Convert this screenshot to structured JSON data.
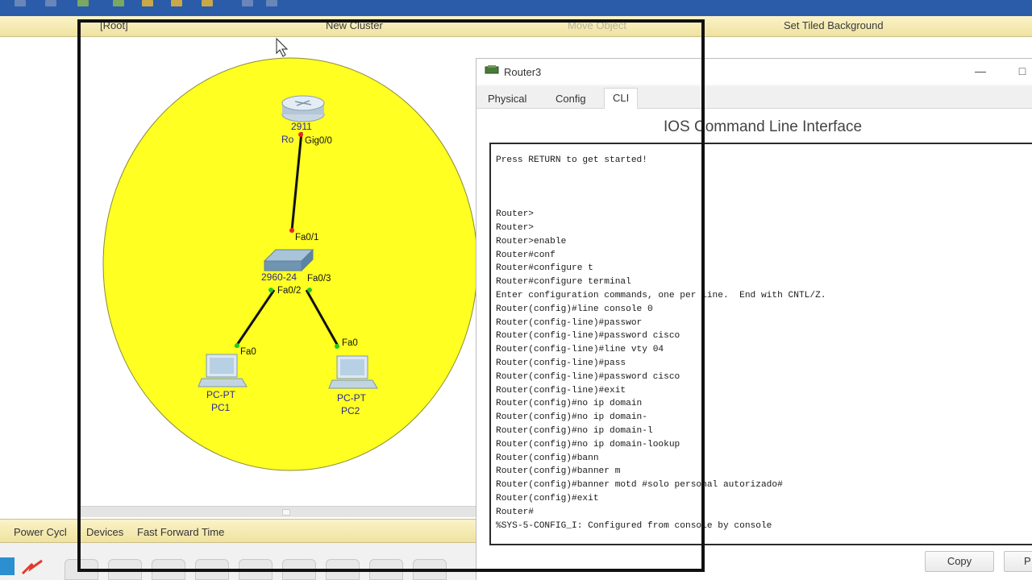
{
  "nav": {
    "root": "[Root]",
    "new_cluster": "New Cluster",
    "move_object": "Move Object",
    "set_tiled_background": "Set Tiled Background"
  },
  "topology": {
    "cluster_color": "#ffff22",
    "router": {
      "model": "2911",
      "name": "Ro",
      "port": "Gig0/0"
    },
    "switch": {
      "model": "2960-24",
      "ports": [
        "Fa0/1",
        "Fa0/2",
        "Fa0/3"
      ]
    },
    "pcs": [
      {
        "type": "PC-PT",
        "name": "PC1",
        "port": "Fa0"
      },
      {
        "type": "PC-PT",
        "name": "PC2",
        "port": "Fa0"
      }
    ]
  },
  "simulation_bar": {
    "power_cycle": "Power Cycl",
    "devices": "Devices",
    "fast_forward": "Fast Forward Time"
  },
  "router_window": {
    "title": "Router3",
    "minimize_icon": "minimize-icon",
    "maximize_icon": "maximize-icon",
    "tabs": [
      "Physical",
      "Config",
      "CLI"
    ],
    "active_tab": "CLI",
    "cli_heading": "IOS Command Line Interface",
    "terminal_lines": [
      "Press RETURN to get started!",
      "",
      "",
      "",
      "Router>",
      "Router>",
      "Router>enable",
      "Router#conf",
      "Router#configure t",
      "Router#configure terminal",
      "Enter configuration commands, one per line.  End with CNTL/Z.",
      "Router(config)#line console 0",
      "Router(config-line)#passwor",
      "Router(config-line)#password cisco",
      "Router(config-line)#line vty 04",
      "Router(config-line)#pass",
      "Router(config-line)#password cisco",
      "Router(config-line)#exit",
      "Router(config)#no ip domain",
      "Router(config)#no ip domain-",
      "Router(config)#no ip domain-l",
      "Router(config)#no ip domain-lookup",
      "Router(config)#bann",
      "Router(config)#banner m",
      "Router(config)#banner motd #solo personal autorizado#",
      "Router(config)#exit",
      "Router#",
      "%SYS-5-CONFIG_I: Configured from console by console"
    ],
    "copy_label": "Copy",
    "paste_label": "P"
  }
}
